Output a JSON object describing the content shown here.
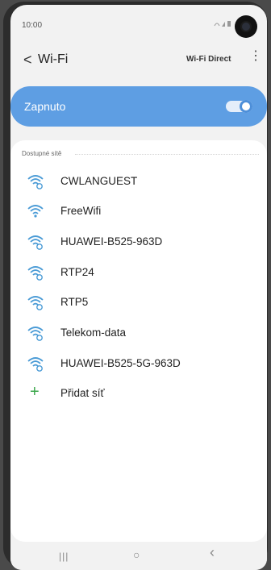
{
  "status": {
    "time": "10:00"
  },
  "toolbar": {
    "title": "Wi-Fi",
    "back_glyph": "<",
    "wifi_direct_label": "Wi-Fi Direct",
    "more_glyph": "⋮"
  },
  "master_switch": {
    "label": "Zapnuto",
    "on": true,
    "accent": "#5e9ee3"
  },
  "networks": {
    "header": "Dostupné sítě",
    "items": [
      {
        "name": "CWLANGUEST",
        "icon": "wifi-secured-icon"
      },
      {
        "name": "FreeWifi",
        "icon": "wifi-icon"
      },
      {
        "name": "HUAWEI-B525-963D",
        "icon": "wifi-secured-icon"
      },
      {
        "name": "RTP24",
        "icon": "wifi-secured-icon"
      },
      {
        "name": "RTP5",
        "icon": "wifi-secured-icon"
      },
      {
        "name": "Telekom-data",
        "icon": "wifi-secured-icon"
      },
      {
        "name": "HUAWEI-B525-5G-963D",
        "icon": "wifi-secured-icon"
      }
    ],
    "add_label": "Přidat síť",
    "icon_color": "#4a9bd6",
    "add_color": "#3aa64a"
  },
  "navbar": {
    "recents": "|||",
    "home": "○",
    "back": "‹"
  }
}
